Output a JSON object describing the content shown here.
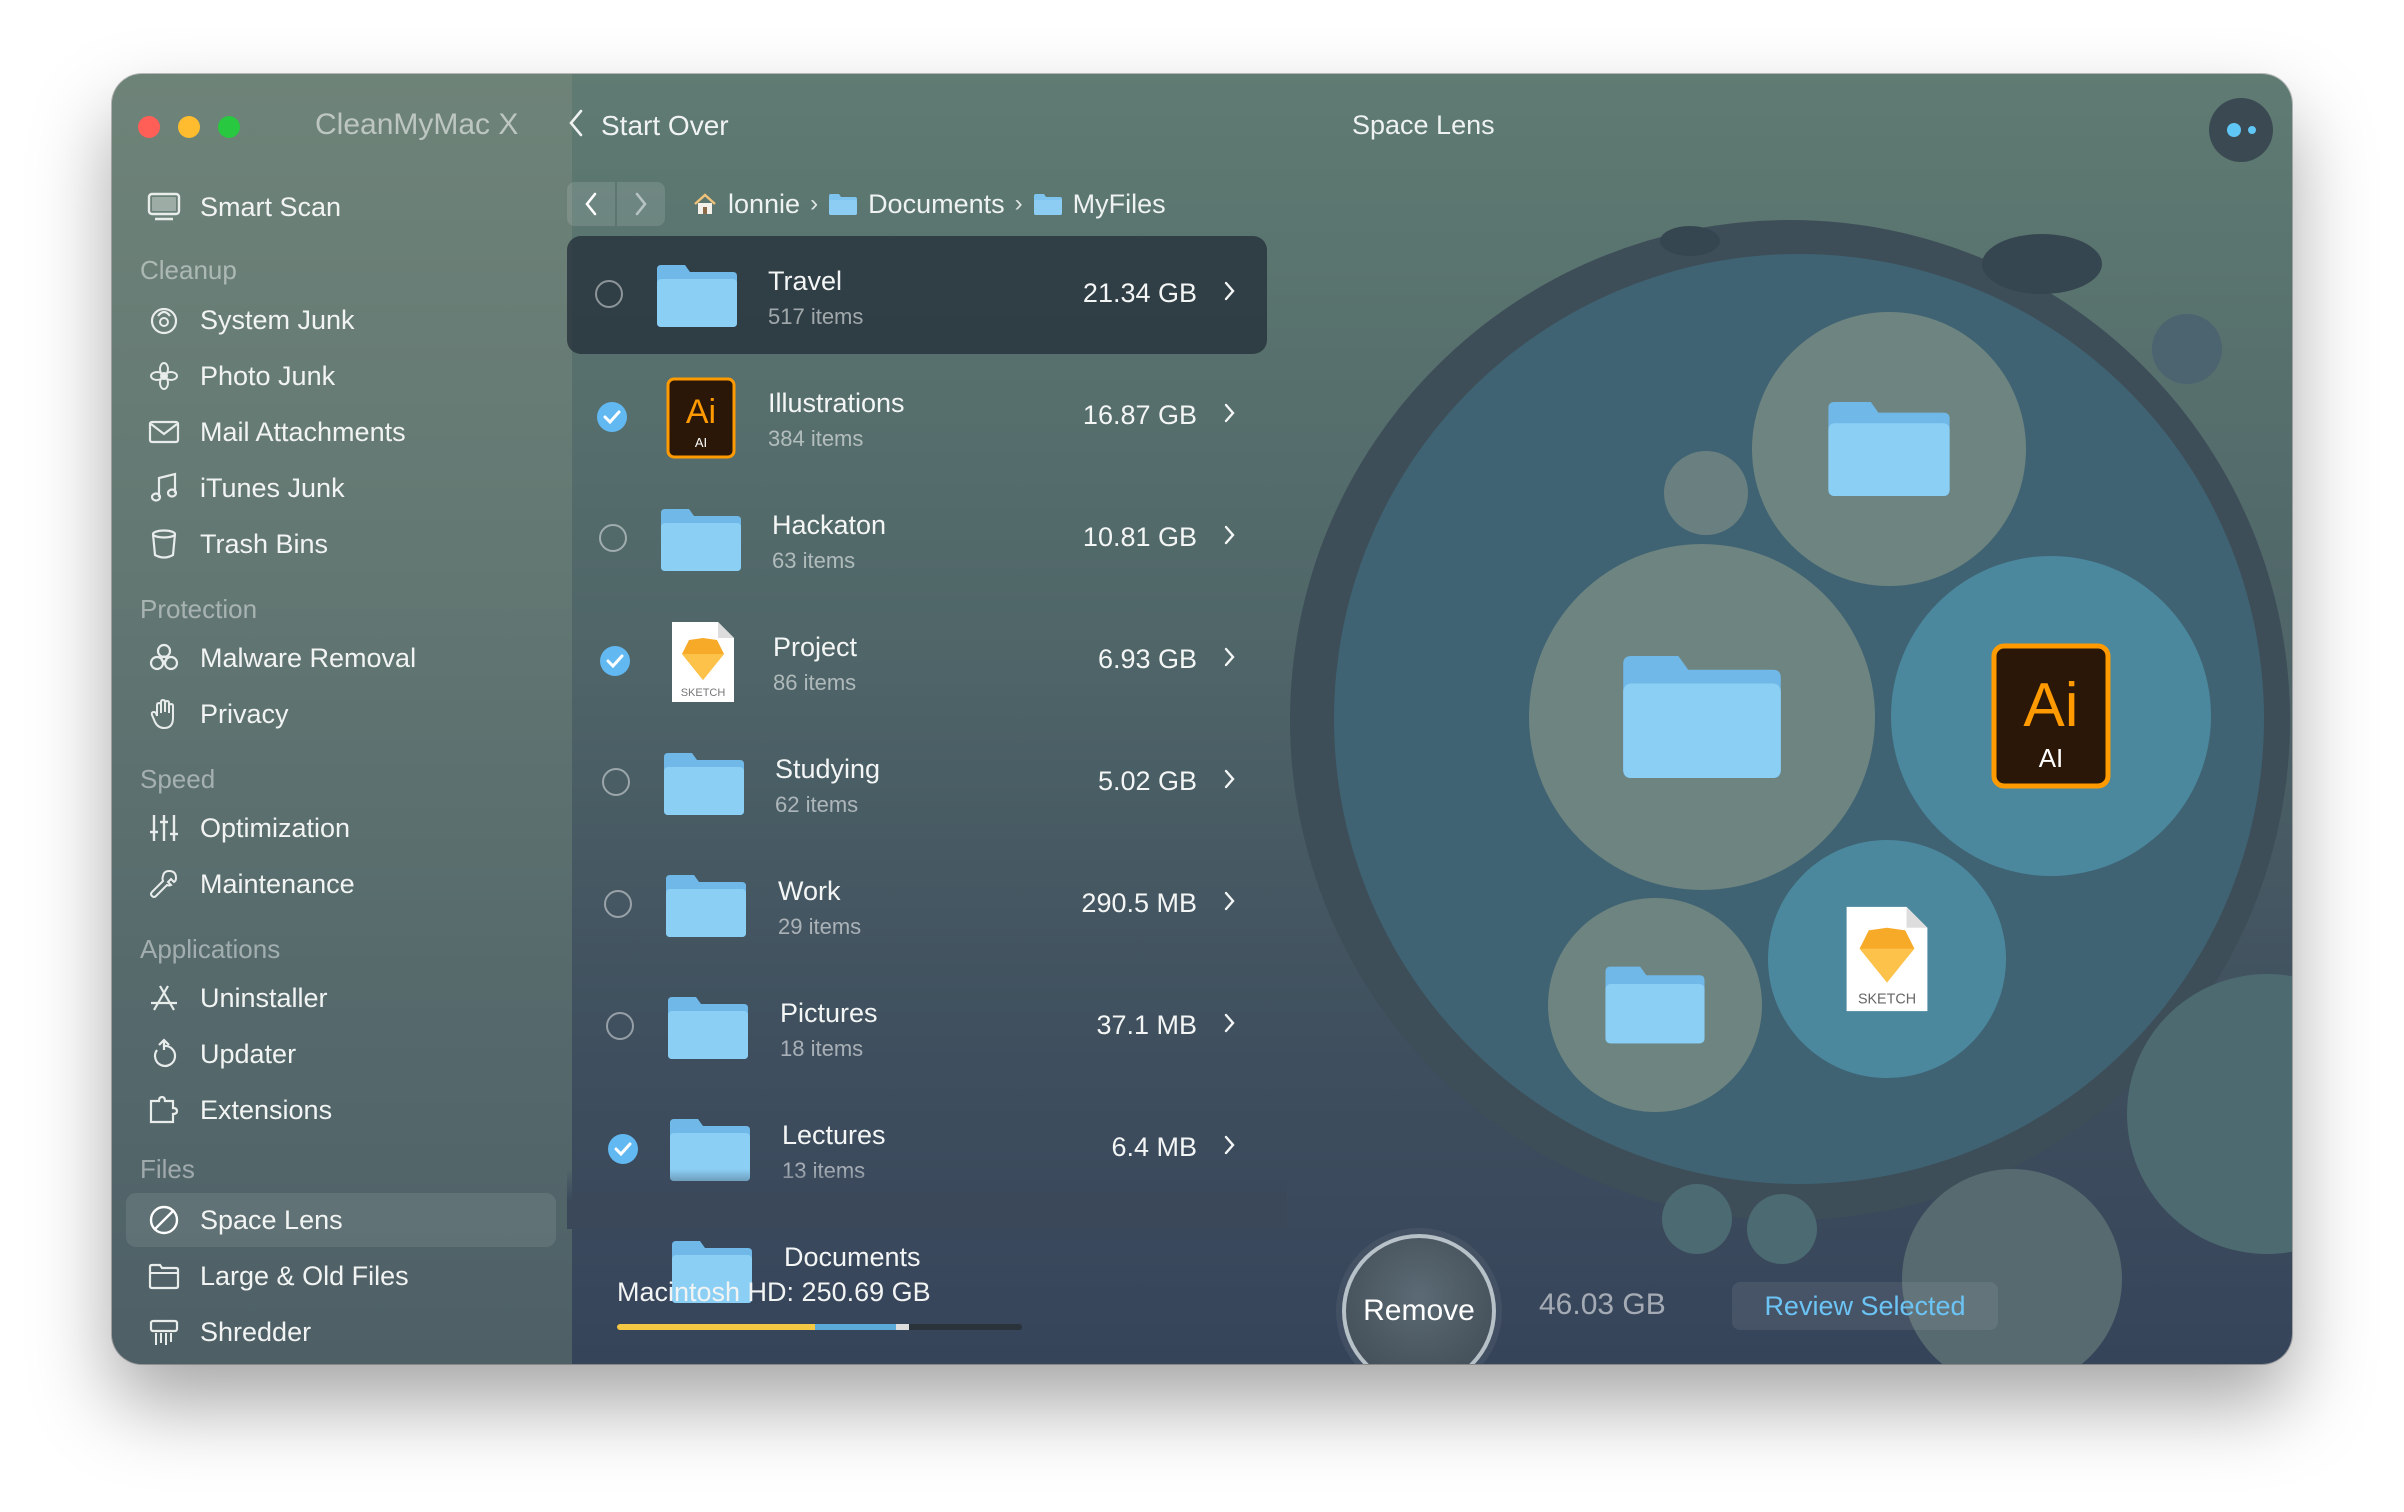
{
  "app": {
    "title": "CleanMyMac X"
  },
  "topbar": {
    "back_label": "Start Over",
    "page_title": "Space Lens"
  },
  "sidebar": {
    "smart_scan": "Smart Scan",
    "sections": {
      "cleanup": "Cleanup",
      "protection": "Protection",
      "speed": "Speed",
      "applications": "Applications",
      "files": "Files"
    },
    "items": {
      "system_junk": "System Junk",
      "photo_junk": "Photo Junk",
      "mail_attachments": "Mail Attachments",
      "itunes_junk": "iTunes Junk",
      "trash_bins": "Trash Bins",
      "malware_removal": "Malware Removal",
      "privacy": "Privacy",
      "optimization": "Optimization",
      "maintenance": "Maintenance",
      "uninstaller": "Uninstaller",
      "updater": "Updater",
      "extensions": "Extensions",
      "space_lens": "Space Lens",
      "large_old_files": "Large & Old Files",
      "shredder": "Shredder"
    }
  },
  "breadcrumb": {
    "home": "lonnie",
    "folder1": "Documents",
    "folder2": "MyFiles"
  },
  "rows": [
    {
      "name": "Travel",
      "count": "517 items",
      "size": "21.34 GB",
      "checked": false,
      "icon": "folder-icon",
      "selected": true
    },
    {
      "name": "Illustrations",
      "count": "384 items",
      "size": "16.87 GB",
      "checked": true,
      "icon": "illustrator-file-icon",
      "selected": false
    },
    {
      "name": "Hackaton",
      "count": "63 items",
      "size": "10.81 GB",
      "checked": false,
      "icon": "folder-icon",
      "selected": false
    },
    {
      "name": "Project",
      "count": "86 items",
      "size": "6.93 GB",
      "checked": true,
      "icon": "sketch-file-icon",
      "selected": false
    },
    {
      "name": "Studying",
      "count": "62 items",
      "size": "5.02 GB",
      "checked": false,
      "icon": "folder-icon",
      "selected": false
    },
    {
      "name": "Work",
      "count": "29 items",
      "size": "290.5 MB",
      "checked": false,
      "icon": "folder-icon",
      "selected": false
    },
    {
      "name": "Pictures",
      "count": "18 items",
      "size": "37.1 MB",
      "checked": false,
      "icon": "folder-icon",
      "selected": false
    },
    {
      "name": "Lectures",
      "count": "13 items",
      "size": "6.4 MB",
      "checked": true,
      "icon": "folder-icon",
      "selected": false
    },
    {
      "name": "Documents",
      "count": "",
      "size": "",
      "checked": false,
      "icon": "folder-icon",
      "selected": false
    }
  ],
  "disk": {
    "label": "Macintosh HD: 250.69 GB",
    "segments": [
      0.49,
      0.2,
      0.03
    ]
  },
  "actions": {
    "remove_label": "Remove",
    "total_size": "46.03 GB",
    "review_label": "Review Selected"
  },
  "bubble_icons": {
    "ai_big": "Ai",
    "ai_small": "AI",
    "sketch": "SKETCH",
    "ai_row_big": "Ai",
    "ai_row_small": "AI",
    "sketch_row": "SKETCH"
  },
  "colors": {
    "accent": "#62b8f0",
    "check": "#62b8f0",
    "folder": "#7fc4ef",
    "ai_orange": "#ff9a00",
    "ai_bg": "#2a1707",
    "sketch": "#f7a928"
  }
}
